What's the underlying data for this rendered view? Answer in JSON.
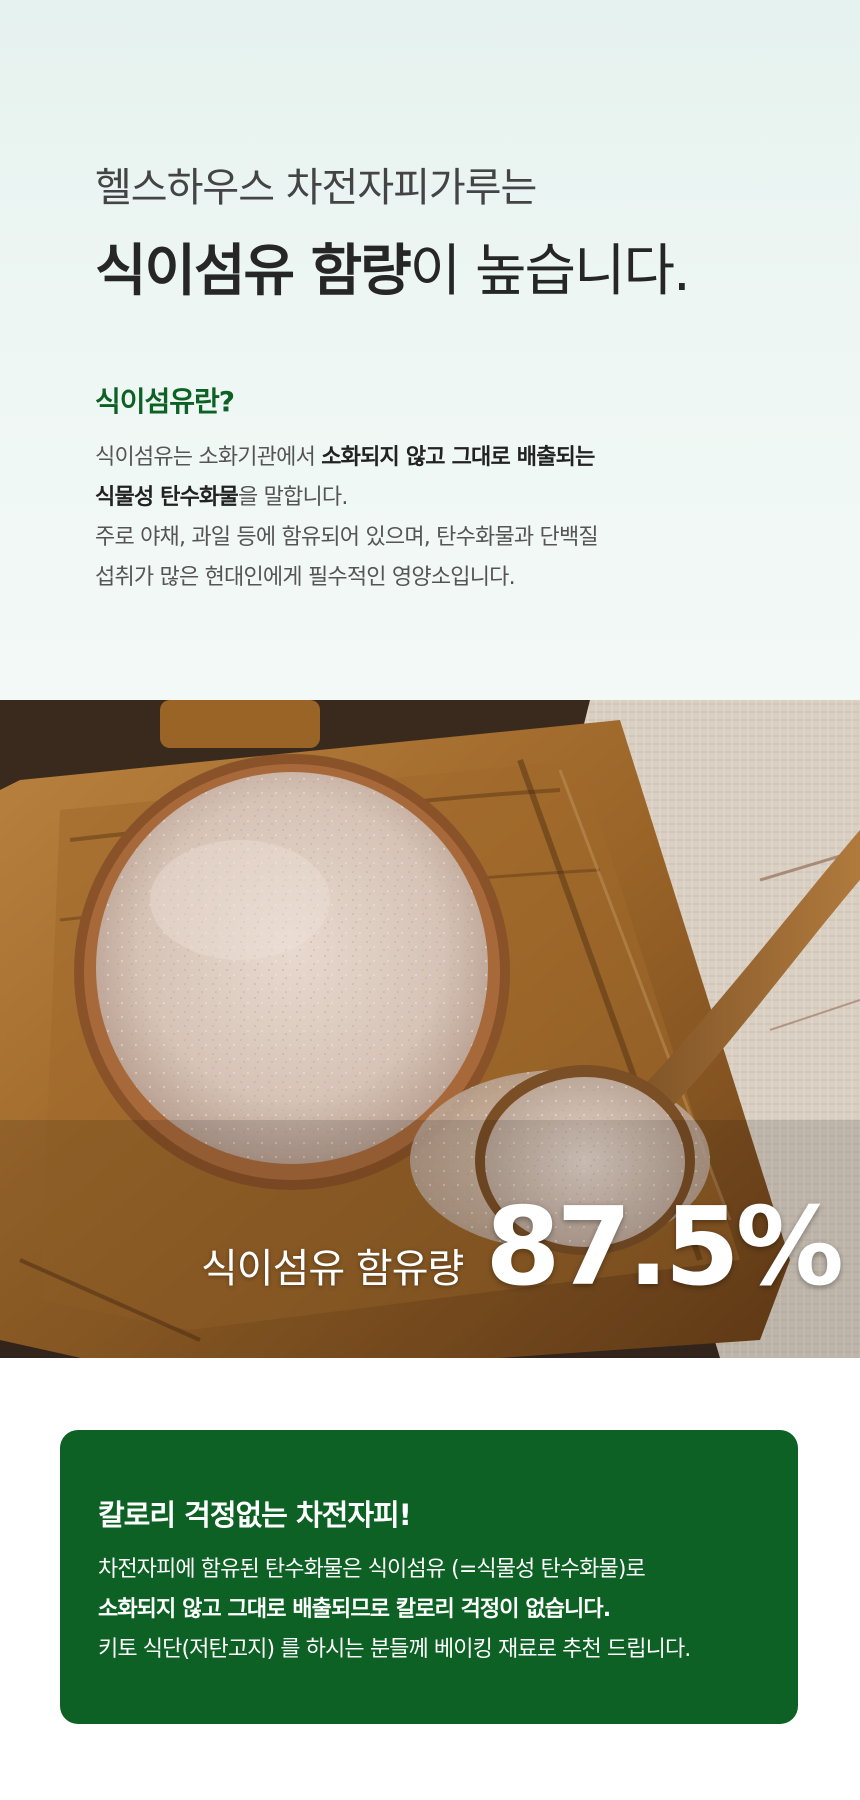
{
  "heading": {
    "subtitle": "헬스하우스 차전자피가루는",
    "title_bold": "식이섬유 함량",
    "title_regular": "이 높습니다."
  },
  "definition": {
    "question": "식이섬유란?",
    "line1_normal": "식이섬유는 소화기관에서 ",
    "line1_bold": "소화되지 않고 그대로 배출되는",
    "line2_bold": "식물성 탄수화물",
    "line2_normal": "을 말합니다.",
    "line3": "주로 야채, 과일 등에 함유되어 있으며, 탄수화물과 단백질",
    "line4": "섭취가 많은 현대인에게 필수적인 영양소입니다."
  },
  "stat": {
    "label": "식이섬유 함유량",
    "value": "87.5%"
  },
  "card": {
    "title": "칼로리 걱정없는 차전자피!",
    "line1": "차전자피에 함유된 탄수화물은 식이섬유 (=식물성 탄수화물)로",
    "line2_bold": "소화되지 않고 그대로 배출되므로 칼로리 걱정이 없습니다.",
    "line3": "키토 식단(저탄고지) 를 하시는 분들께 베이킹 재료로 추천 드립니다."
  },
  "colors": {
    "accent_green": "#0e6124",
    "top_background": "#e6f2ef",
    "text_dark": "#262626"
  }
}
